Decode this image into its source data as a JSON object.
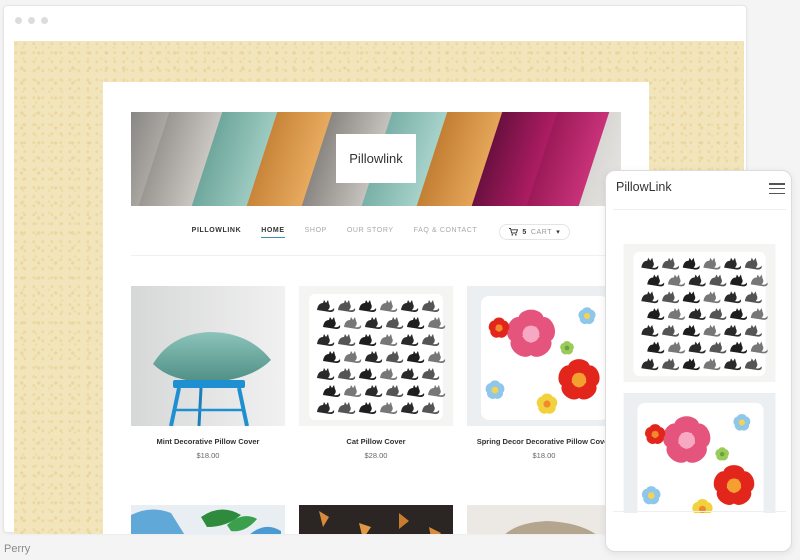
{
  "brand": "Pillowlink",
  "nav": {
    "brand": "PILLOWLINK",
    "items": [
      "HOME",
      "SHOP",
      "OUR STORY",
      "FAQ & CONTACT"
    ],
    "cart_count": "5",
    "cart_label": "CART",
    "cart_caret": "▾"
  },
  "products": [
    {
      "name": "Mint Decorative Pillow Cover",
      "price": "$18.00"
    },
    {
      "name": "Cat Pillow Cover",
      "price": "$28.00"
    },
    {
      "name": "Spring Decor Decorative Pillow Cover",
      "price": "$18.00"
    }
  ],
  "mobile": {
    "title": "PillowLink"
  },
  "caption": "Perry",
  "colors": {
    "background_pattern": "#f3e5bb",
    "nav_active_underline": "#3a8fb7"
  },
  "icons": [
    "cart-icon",
    "hamburger-menu-icon"
  ]
}
